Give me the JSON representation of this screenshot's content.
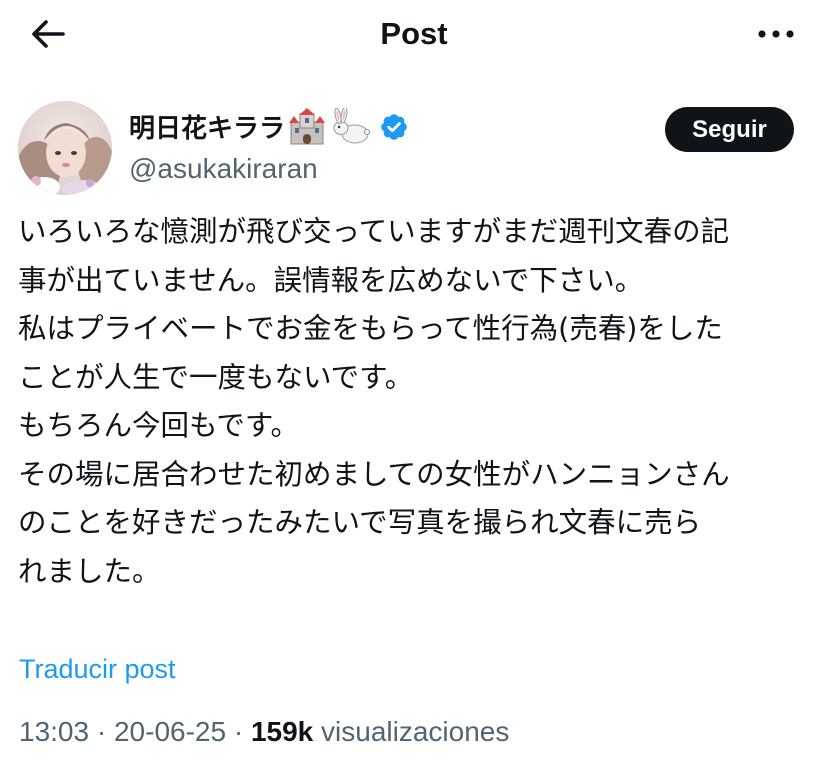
{
  "header": {
    "title": "Post",
    "back_icon": "arrow-left-icon",
    "more_icon": "more-horizontal-icon"
  },
  "author": {
    "display_name": "明日花キララ",
    "emoji": [
      "castle-emoji",
      "rabbit-emoji"
    ],
    "verified": true,
    "verified_color": "#1d9bf0",
    "handle": "@asukakiraran"
  },
  "follow_button": {
    "label": "Seguir"
  },
  "post": {
    "lines": [
      "いろいろな憶測が飛び交っていますがまだ週刊文春の記",
      "事が出ていません。誤情報を広めないで下さい。",
      "私はプライベートでお金をもらって性行為(売春)をした",
      "ことが人生で一度もないです。",
      "もちろん今回もです。",
      "その場に居合わせた初めましての女性がハンニョンさん",
      "のことを好きだったみたいで写真を撮られ文春に売ら",
      "れました。"
    ]
  },
  "translate_link": "Traducir post",
  "meta": {
    "time": "13:03",
    "separator": "·",
    "date": "20-06-25",
    "views_count": "159k",
    "views_label": "visualizaciones"
  },
  "colors": {
    "text": "#0f1419",
    "secondary": "#536471",
    "link": "#1d9bf0",
    "button_bg": "#0f1419"
  }
}
